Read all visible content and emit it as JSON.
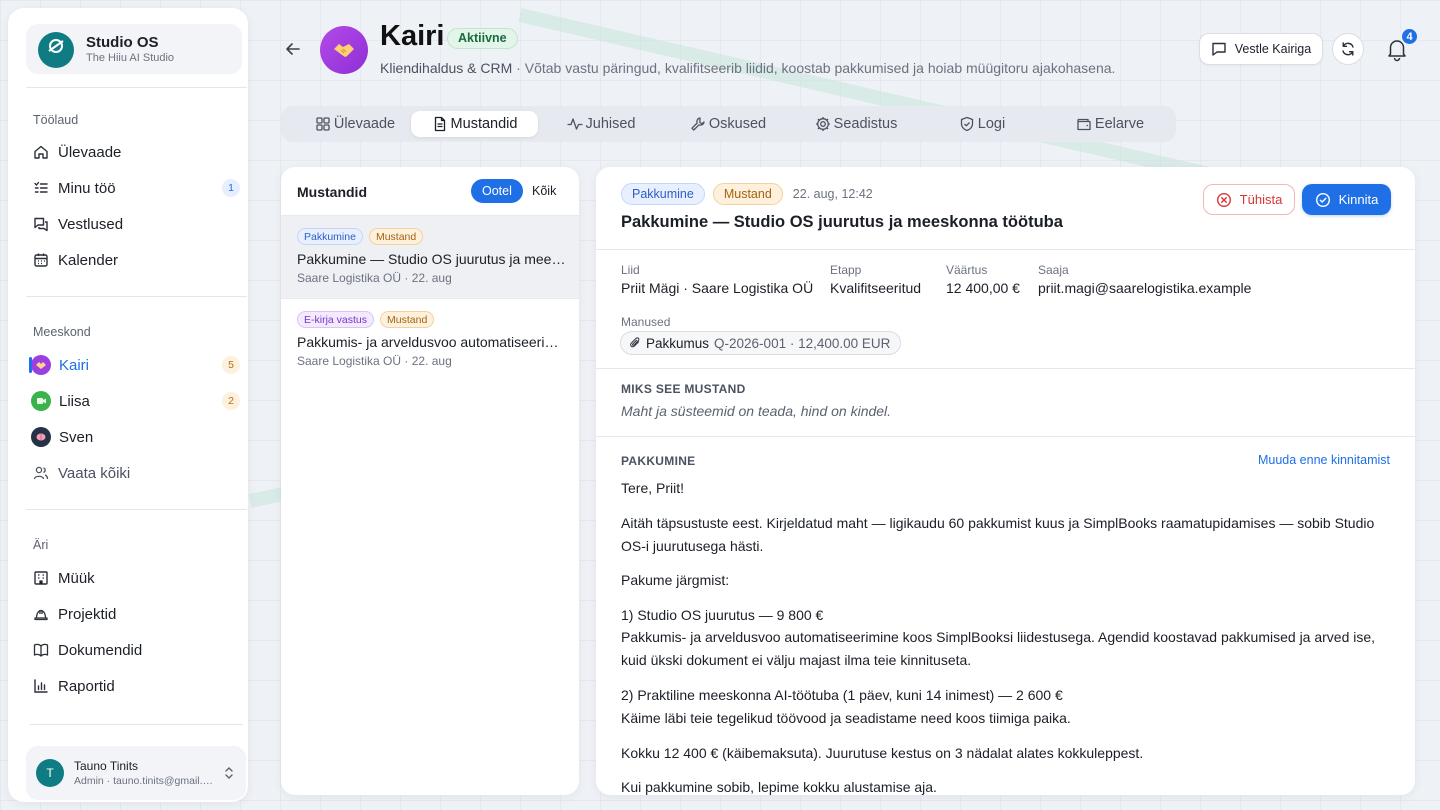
{
  "brand": {
    "name": "Studio OS",
    "subtitle": "The Hiiu AI Studio"
  },
  "sidebar": {
    "sections": {
      "workspace": "Töölaud",
      "team": "Meeskond",
      "business": "Äri"
    },
    "workspace_items": [
      {
        "label": "Ülevaade",
        "icon": "home-icon"
      },
      {
        "label": "Minu töö",
        "icon": "list-icon",
        "count": "1"
      },
      {
        "label": "Vestlused",
        "icon": "chat-icon"
      },
      {
        "label": "Kalender",
        "icon": "calendar-icon"
      }
    ],
    "team_items": [
      {
        "label": "Kairi",
        "count": "5"
      },
      {
        "label": "Liisa",
        "count": "2"
      },
      {
        "label": "Sven"
      },
      {
        "label": "Vaata kõiki",
        "icon": "users-icon"
      }
    ],
    "business_items": [
      {
        "label": "Müük",
        "icon": "building-icon"
      },
      {
        "label": "Projektid",
        "icon": "hardhat-icon"
      },
      {
        "label": "Dokumendid",
        "icon": "book-icon"
      },
      {
        "label": "Raportid",
        "icon": "chart-icon"
      }
    ]
  },
  "user": {
    "initial": "T",
    "name": "Tauno Tinits",
    "subtitle": "Admin · tauno.tinits@gmail.com"
  },
  "header": {
    "agent_name": "Kairi",
    "status": "Aktiivne",
    "role": "Kliendihaldus & CRM",
    "description": " · Võtab vastu päringud, kvalifitseerib liidid, koostab pakkumised ja hoiab müügitoru ajakohasena.",
    "chat_button": "Vestle Kairiga",
    "notifications_count": "4"
  },
  "tabs": [
    {
      "label": "Ülevaade",
      "icon": "grid-icon"
    },
    {
      "label": "Mustandid",
      "icon": "document-icon",
      "active": true
    },
    {
      "label": "Juhised",
      "icon": "activity-icon"
    },
    {
      "label": "Oskused",
      "icon": "wrench-icon"
    },
    {
      "label": "Seadistus",
      "icon": "gear-icon"
    },
    {
      "label": "Logi",
      "icon": "shield-icon"
    },
    {
      "label": "Eelarve",
      "icon": "wallet-icon"
    }
  ],
  "drafts_list": {
    "title": "Mustandid",
    "filter_pending": "Ootel",
    "filter_all": "Kõik",
    "items": [
      {
        "type": "Pakkumine",
        "type_color": "blue",
        "status": "Mustand",
        "title": "Pakkumine — Studio OS juurutus ja meeskonna töötuba",
        "meta": "Saare Logistika OÜ · 22. aug"
      },
      {
        "type": "E-kirja vastus",
        "type_color": "purple",
        "status": "Mustand",
        "title": "Pakkumis- ja arveldusvoo automatiseerimine",
        "meta": "Saare Logistika OÜ · 22. aug"
      }
    ]
  },
  "detail": {
    "type": "Pakkumine",
    "status": "Mustand",
    "date": "22. aug, 12:42",
    "title": "Pakkumine — Studio OS juurutus ja meeskonna töötuba",
    "cancel": "Tühista",
    "confirm": "Kinnita",
    "fields": {
      "lead_label": "Liid",
      "lead_value": "Priit Mägi · Saare Logistika OÜ",
      "stage_label": "Etapp",
      "stage_value": "Kvalifitseeritud",
      "value_label": "Väärtus",
      "value_value": "12 400,00 €",
      "recipient_label": "Saaja",
      "recipient_value": "priit.magi@saarelogistika.example"
    },
    "attachments_label": "Manused",
    "attachment_name": "Pakkumus",
    "attachment_rest": "Q-2026-001 · 12,400.00 EUR",
    "why_heading": "MIKS SEE MUSTAND",
    "why_text": "Maht ja süsteemid on teada, hind on kindel.",
    "body_heading": "PAKKUMINE",
    "edit_link": "Muuda enne kinnitamist",
    "body": {
      "greeting": "Tere, Priit!",
      "p1": "Aitäh täpsustuste eest. Kirjeldatud maht — ligikaudu 60 pakkumist kuus ja SimplBooks raamatupidamises — sobib Studio OS-i juurutusega hästi.",
      "p2": "Pakume järgmist:",
      "item1_title": "1) Studio OS juurutus — 9 800 €",
      "item1_text": "Pakkumis- ja arveldusvoo automatiseerimine koos SimplBooksi liidestusega. Agendid koostavad pakkumised ja arved ise, kuid ükski dokument ei välju majast ilma teie kinnituseta.",
      "item2_title": "2) Praktiline meeskonna AI-töötuba (1 päev, kuni 14 inimest) — 2 600 €",
      "item2_text": "Käime läbi teie tegelikud töövood ja seadistame need koos tiimiga paika.",
      "total": "Kokku 12 400 € (käibemaksuta). Juurutuse kestus on 3 nädalat alates kokkuleppest.",
      "closing": "Kui pakkumine sobib, lepime kokku alustamise aja."
    }
  },
  "colors": {
    "accent": "#1f6fe6",
    "agent": "#9b3fe0",
    "success": "#1c6b3f",
    "danger": "#d93636"
  }
}
